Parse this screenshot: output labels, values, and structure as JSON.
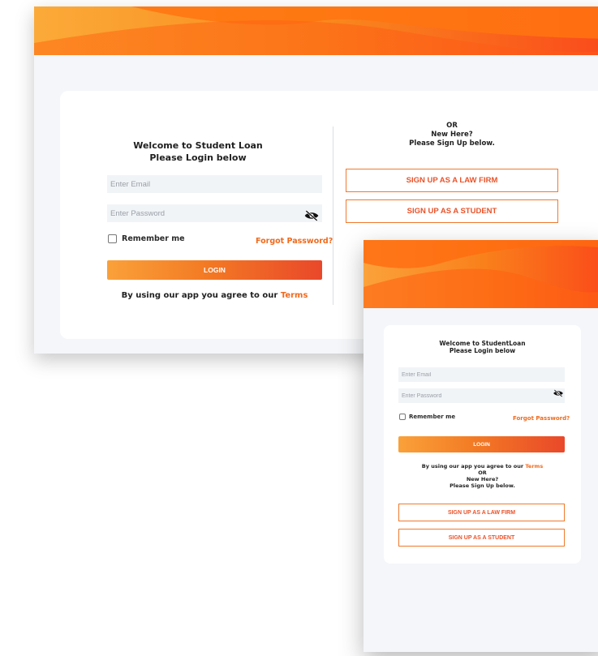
{
  "colors": {
    "accent": "#f06a1d",
    "gradient_start": "#faa13a",
    "gradient_end": "#e9482a",
    "signup_border": "#f07a2c",
    "page_background": "#f4f6f9"
  },
  "icons": {
    "password_toggle": "eye-off-icon"
  },
  "desktop": {
    "welcome_line1": "Welcome to Student Loan",
    "welcome_line2": "Please Login below",
    "email_placeholder": "Enter Email",
    "password_placeholder": "Enter Password",
    "remember_label": "Remember me",
    "forgot_label": "Forgot Password?",
    "login_label": "LOGIN",
    "terms_text": "By using  our app you agree to our ",
    "terms_link": "Terms",
    "or_label": "OR",
    "new_here": "New Here?",
    "signup_prompt": "Please Sign Up below.",
    "signup_law_firm": "SIGN UP AS A LAW FIRM",
    "signup_student": "SIGN UP AS A STUDENT"
  },
  "mobile": {
    "welcome_line1": "Welcome to StudentLoan",
    "welcome_line2": "Please Login below",
    "email_placeholder": "Enter Email",
    "password_placeholder": "Enter Password",
    "remember_label": "Remember me",
    "forgot_label": "Forgot Password?",
    "login_label": "LOGIN",
    "terms_text": "By using our app you agree to our ",
    "terms_link": "Terms",
    "or_label": "OR",
    "new_here": "New Here?",
    "signup_prompt": "Please Sign Up below.",
    "signup_law_firm": "SIGN UP AS A LAW FIRM",
    "signup_student": "SIGN UP AS A STUDENT"
  }
}
